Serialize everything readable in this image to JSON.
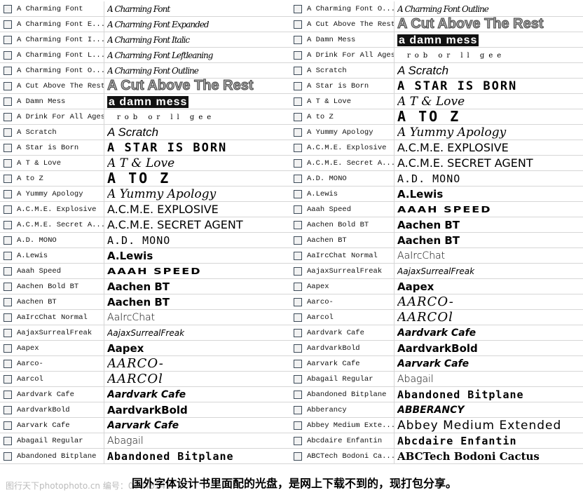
{
  "left": [
    {
      "name": "A Charming Font",
      "preview": "A Charming Font",
      "style": "script"
    },
    {
      "name": "A Charming Font E...",
      "preview": "A Charming Font Expanded",
      "style": "script"
    },
    {
      "name": "A Charming Font I...",
      "preview": "A Charming Font Italic",
      "style": "script"
    },
    {
      "name": "A Charming Font L...",
      "preview": "A Charming Font Leftleaning",
      "style": "script"
    },
    {
      "name": "A Charming Font O...",
      "preview": "A Charming Font Outline",
      "style": "script"
    },
    {
      "name": "A Cut Above The Rest",
      "preview": "A Cut Above The Rest",
      "style": "bigbold"
    },
    {
      "name": "A Damn Mess",
      "preview": "a damn mess",
      "style": "mess"
    },
    {
      "name": "A Drink For All Ages",
      "preview": "rob or ll gee",
      "style": "tiny"
    },
    {
      "name": "A Scratch",
      "preview": "A Scratch",
      "style": "italic"
    },
    {
      "name": "A Star is Born",
      "preview": "A STAR IS BORN",
      "style": "block"
    },
    {
      "name": "A T  & Love",
      "preview": "A T & Love",
      "style": "hand"
    },
    {
      "name": "A to Z",
      "preview": "A TO Z",
      "style": "wide"
    },
    {
      "name": "A Yummy Apology",
      "preview": "A Yummy Apology",
      "style": "hand"
    },
    {
      "name": "A.C.M.E. Explosive",
      "preview": "A.C.M.E. EXPLOSIVE",
      "style": "sans"
    },
    {
      "name": "A.C.M.E. Secret A...",
      "preview": "A.C.M.E. SECRET AGENT",
      "style": "sans"
    },
    {
      "name": "A.D. MONO",
      "preview": "A.D. MONO",
      "style": "thin"
    },
    {
      "name": "A.Lewis",
      "preview": "A.Lewis",
      "style": "bold"
    },
    {
      "name": "Aaah Speed",
      "preview": "AAAH SPEED",
      "style": "speed"
    },
    {
      "name": "Aachen Bold BT",
      "preview": "Aachen BT",
      "style": "bold"
    },
    {
      "name": "Aachen BT",
      "preview": "Aachen BT",
      "style": "bold"
    },
    {
      "name": "AaIrcChat Normal",
      "preview": "AaIrcChat",
      "style": "light"
    },
    {
      "name": "AajaxSurrealFreak",
      "preview": "AajaxSurrealFreak",
      "style": "small"
    },
    {
      "name": "Aapex",
      "preview": "Aapex",
      "style": "bold"
    },
    {
      "name": "Aarco-",
      "preview": "AARCO-",
      "style": "jag"
    },
    {
      "name": "Aarcol",
      "preview": "AARCOl",
      "style": "jag"
    },
    {
      "name": "Aardvark Cafe",
      "preview": "Aardvark Cafe",
      "style": "bi"
    },
    {
      "name": "AardvarkBold",
      "preview": "AardvarkBold",
      "style": "bold"
    },
    {
      "name": "Aarvark Cafe",
      "preview": "Aarvark Cafe",
      "style": "bi"
    },
    {
      "name": "Abagail Regular",
      "preview": "Abagail",
      "style": "light"
    },
    {
      "name": "Abandoned Bitplane",
      "preview": "Abandoned Bitplane",
      "style": "bitmap"
    }
  ],
  "right": [
    {
      "name": "A Charming Font O...",
      "preview": "A Charming Font Outline",
      "style": "script"
    },
    {
      "name": "A Cut Above The Rest",
      "preview": "A Cut Above The Rest",
      "style": "bigbold"
    },
    {
      "name": "A Damn Mess",
      "preview": "a damn mess",
      "style": "mess"
    },
    {
      "name": "A Drink For All Ages",
      "preview": "rob or ll gee",
      "style": "tiny"
    },
    {
      "name": "A Scratch",
      "preview": "A Scratch",
      "style": "italic"
    },
    {
      "name": "A Star is Born",
      "preview": "A STAR IS BORN",
      "style": "block"
    },
    {
      "name": "A T  & Love",
      "preview": "A T & Love",
      "style": "hand"
    },
    {
      "name": "A to Z",
      "preview": "A TO Z",
      "style": "wide"
    },
    {
      "name": "A Yummy Apology",
      "preview": "A Yummy Apology",
      "style": "hand"
    },
    {
      "name": "A.C.M.E. Explosive",
      "preview": "A.C.M.E. EXPLOSIVE",
      "style": "sans"
    },
    {
      "name": "A.C.M.E. Secret A...",
      "preview": "A.C.M.E. SECRET AGENT",
      "style": "sans"
    },
    {
      "name": "A.D. MONO",
      "preview": "A.D. MONO",
      "style": "thin"
    },
    {
      "name": "A.Lewis",
      "preview": "A.Lewis",
      "style": "bold"
    },
    {
      "name": "Aaah Speed",
      "preview": "AAAH SPEED",
      "style": "speed"
    },
    {
      "name": "Aachen Bold BT",
      "preview": "Aachen BT",
      "style": "bold"
    },
    {
      "name": "Aachen BT",
      "preview": "Aachen BT",
      "style": "bold"
    },
    {
      "name": "AaIrcChat Normal",
      "preview": "AaIrcChat",
      "style": "light"
    },
    {
      "name": "AajaxSurrealFreak",
      "preview": "AajaxSurrealFreak",
      "style": "small"
    },
    {
      "name": "Aapex",
      "preview": "Aapex",
      "style": "bold"
    },
    {
      "name": "Aarco-",
      "preview": "AARCO-",
      "style": "jag"
    },
    {
      "name": "Aarcol",
      "preview": "AARCOl",
      "style": "jag"
    },
    {
      "name": "Aardvark Cafe",
      "preview": "Aardvark Cafe",
      "style": "bi"
    },
    {
      "name": "AardvarkBold",
      "preview": "AardvarkBold",
      "style": "bold"
    },
    {
      "name": "Aarvark Cafe",
      "preview": "Aarvark Cafe",
      "style": "bi"
    },
    {
      "name": "Abagail Regular",
      "preview": "Abagail",
      "style": "light"
    },
    {
      "name": "Abandoned Bitplane",
      "preview": "Abandoned Bitplane",
      "style": "bitmap"
    },
    {
      "name": "Abberancy",
      "preview": "ABBERANCY",
      "style": "bi"
    },
    {
      "name": "Abbey Medium Exte...",
      "preview": "Abbey Medium Extended",
      "style": "ext"
    },
    {
      "name": "Abcdaire Enfantin",
      "preview": "Abcdaire Enfantin",
      "style": "bitmap"
    },
    {
      "name": "ABCTech Bodoni Ca...",
      "preview": "ABCTech Bodoni Cactus",
      "style": "bodoni"
    }
  ],
  "caption": "国外字体设计书里面配的光盘，是网上下载不到的，现打包分享。",
  "watermark": "图行天下photophoto.cn 编号：08045245"
}
